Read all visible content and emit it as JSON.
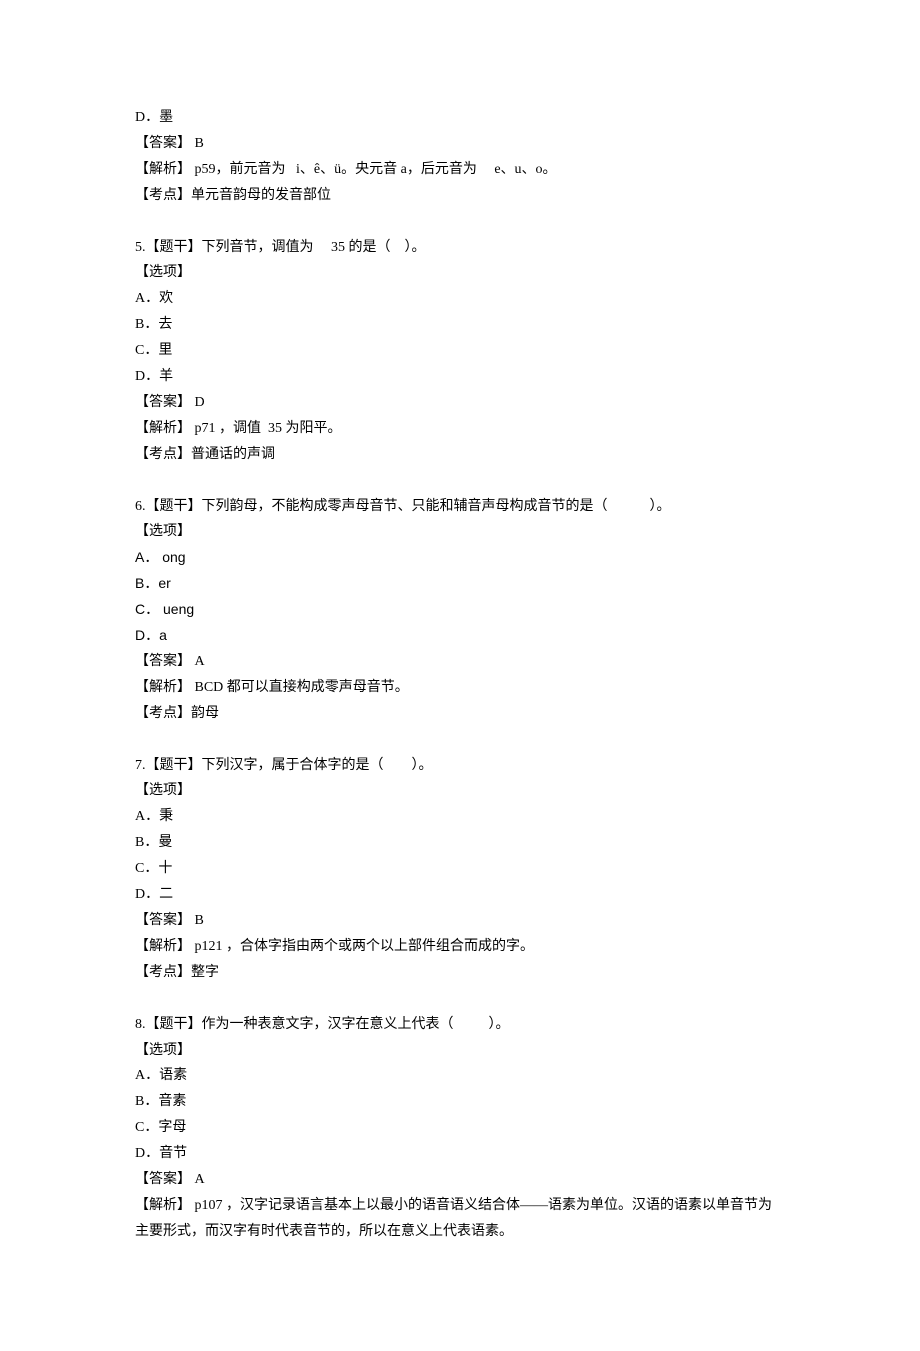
{
  "intro": {
    "lines": [
      "D．墨",
      "【答案】 B",
      "【解析】 p59，前元音为   i、ê、ü。央元音 a，后元音为     e、u、o。",
      "【考点】单元音韵母的发音部位"
    ]
  },
  "questions": [
    {
      "stem": "5.【题干】下列音节，调值为     35 的是（    ）。",
      "options_label": "【选项】",
      "options": [
        "A．欢",
        "B．去",
        "C．里",
        "D．羊"
      ],
      "answer": "【答案】 D",
      "explain": "【解析】 p71 ，调值  35 为阳平。",
      "point": "【考点】普通话的声调"
    },
    {
      "stem": "6.【题干】下列韵母，不能构成零声母音节、只能和辅音声母构成音节的是（            ）。",
      "options_label": "【选项】",
      "options": [
        "A． ong",
        "B．er",
        "C． ueng",
        "D．a"
      ],
      "answer": "【答案】 A",
      "explain": "【解析】 BCD 都可以直接构成零声母音节。",
      "point": "【考点】韵母"
    },
    {
      "stem": "7.【题干】下列汉字，属于合体字的是（        ）。",
      "options_label": "【选项】",
      "options": [
        "A．秉",
        "B．曼",
        "C．十",
        "D．二"
      ],
      "answer": "【答案】 B",
      "explain": "【解析】 p121 ，合体字指由两个或两个以上部件组合而成的字。",
      "point": "【考点】整字"
    },
    {
      "stem": "8.【题干】作为一种表意文字，汉字在意义上代表（          ）。",
      "options_label": "【选项】",
      "options": [
        "A．语素",
        "B．音素",
        "C．字母",
        "D．音节"
      ],
      "answer": "【答案】 A",
      "explain": "【解析】 p107 ，汉字记录语言基本上以最小的语音语义结合体——语素为单位。汉语的语素以单音节为主要形式，而汉字有时代表音节的，所以在意义上代表语素。",
      "point": ""
    }
  ]
}
